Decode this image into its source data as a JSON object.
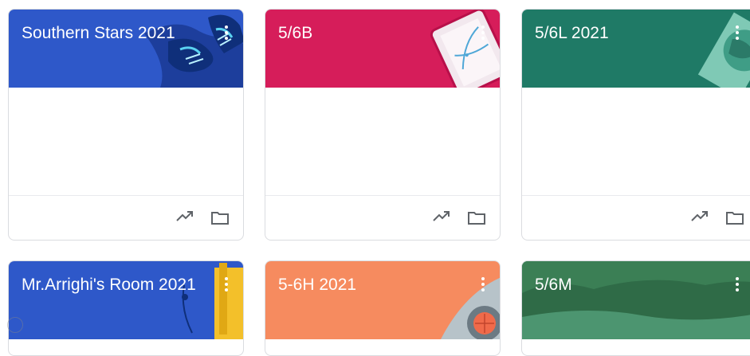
{
  "classes": [
    {
      "name": "Southern Stars 2021",
      "color": "#2e58c9"
    },
    {
      "name": "5/6B",
      "color": "#d61d5a"
    },
    {
      "name": "5/6L 2021",
      "color": "#1f7a66"
    },
    {
      "name": "Mr.Arrighi's Room 2021",
      "color": "#2e58c9"
    },
    {
      "name": "5-6H 2021",
      "color": "#f68b5f"
    },
    {
      "name": "5/6M",
      "color": "#2e7d4f"
    }
  ],
  "icons": {
    "menu": "more-vert-icon",
    "trend": "trending-up-icon",
    "folder": "folder-icon"
  }
}
